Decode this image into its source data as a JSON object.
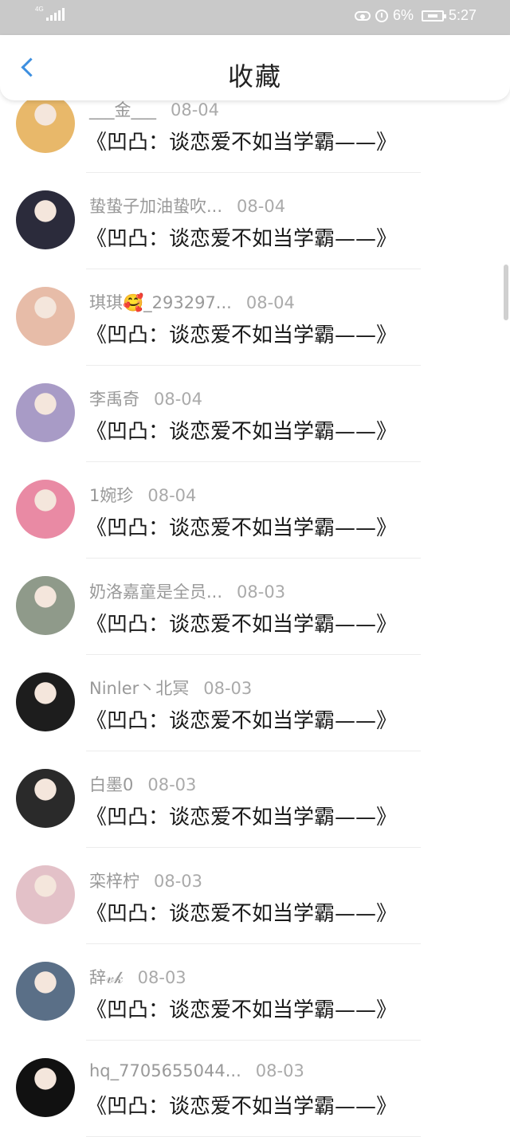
{
  "status_bar": {
    "network": "4G",
    "battery": "6%",
    "time": "5:27"
  },
  "header": {
    "title": "收藏",
    "back_icon": "chevron-left-icon"
  },
  "items": [
    {
      "user": "___金___",
      "date": "08-04",
      "content": "《凹凸：谈恋爱不如当学霸——》",
      "avatar_color": "#e8b86a"
    },
    {
      "user": "蛰蛰子加油蛰吹...",
      "date": "08-04",
      "content": "《凹凸：谈恋爱不如当学霸——》",
      "avatar_color": "#2b2b3b"
    },
    {
      "user": "琪琪🥰_293297...",
      "date": "08-04",
      "content": "《凹凸：谈恋爱不如当学霸——》",
      "avatar_color": "#e7bca8"
    },
    {
      "user": "李禹奇",
      "date": "08-04",
      "content": "《凹凸：谈恋爱不如当学霸——》",
      "avatar_color": "#a89bc6"
    },
    {
      "user": "1婉珍",
      "date": "08-04",
      "content": "《凹凸：谈恋爱不如当学霸——》",
      "avatar_color": "#e98aa4"
    },
    {
      "user": "奶洛嘉童是全员...",
      "date": "08-03",
      "content": "《凹凸：谈恋爱不如当学霸——》",
      "avatar_color": "#8f9a8a"
    },
    {
      "user": "Ninler丶北冥",
      "date": "08-03",
      "content": "《凹凸：谈恋爱不如当学霸——》",
      "avatar_color": "#1d1d1d"
    },
    {
      "user": "白墨0",
      "date": "08-03",
      "content": "《凹凸：谈恋爱不如当学霸——》",
      "avatar_color": "#2a2a2a"
    },
    {
      "user": "栾梓柠",
      "date": "08-03",
      "content": "《凹凸：谈恋爱不如当学霸——》",
      "avatar_color": "#e3c1c8"
    },
    {
      "user": "辞𝓋𝓀",
      "date": "08-03",
      "content": "《凹凸：谈恋爱不如当学霸——》",
      "avatar_color": "#5a6f87"
    },
    {
      "user": "hq_7705655044...",
      "date": "08-03",
      "content": "《凹凸：谈恋爱不如当学霸——》",
      "avatar_color": "#111111"
    }
  ]
}
